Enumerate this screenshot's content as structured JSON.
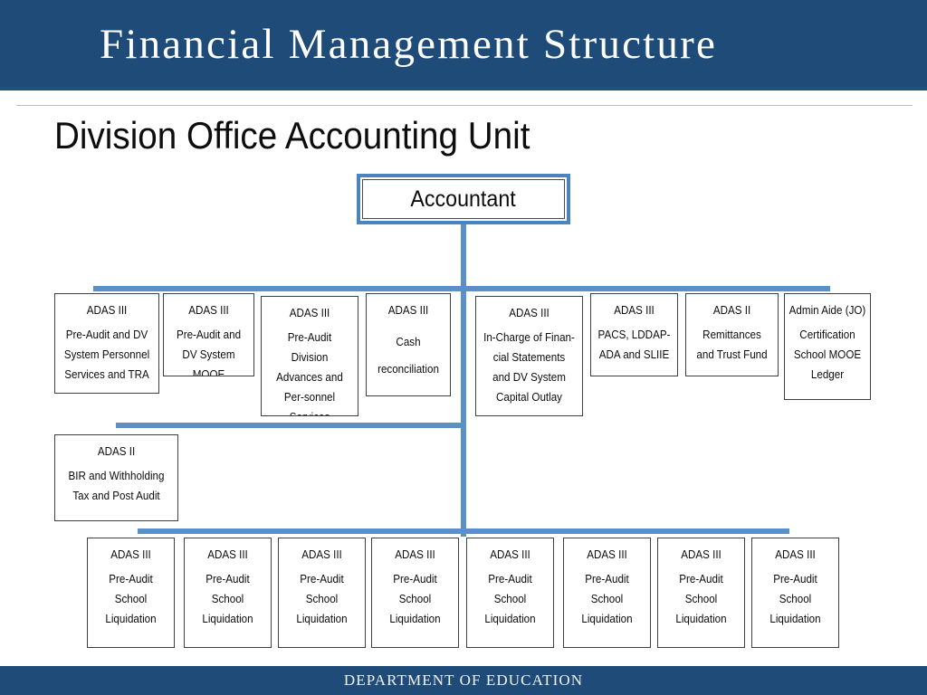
{
  "header": {
    "title": "Financial Management Structure"
  },
  "subtitle": "Division Office Accounting Unit",
  "root": {
    "label": "Accountant"
  },
  "row1": [
    {
      "role": "ADAS III",
      "desc": "Pre-Audit and DV System Personnel Services and TRA"
    },
    {
      "role": "ADAS III",
      "desc": "Pre-Audit and DV System MOOE"
    },
    {
      "role": "ADAS III",
      "desc": "Pre-Audit Division Advances and Per-sonnel Services"
    },
    {
      "role": "ADAS III",
      "desc": "Cash reconciliation"
    },
    {
      "role": "ADAS III",
      "desc": "In-Charge of Finan-cial Statements and DV System Capital Outlay"
    },
    {
      "role": "ADAS III",
      "desc": "PACS, LDDAP-ADA and SLIIE"
    },
    {
      "role": "ADAS II",
      "desc": "Remittances and Trust Fund"
    },
    {
      "role": "Admin Aide (JO)",
      "desc": "Certification School MOOE Ledger"
    }
  ],
  "row2": [
    {
      "role": "ADAS II",
      "desc": "BIR and Withholding Tax and Post Audit"
    }
  ],
  "row3": [
    {
      "role": "ADAS III",
      "desc": "Pre-Audit School Liquidation"
    },
    {
      "role": "ADAS III",
      "desc": "Pre-Audit School Liquidation"
    },
    {
      "role": "ADAS III",
      "desc": "Pre-Audit School Liquidation"
    },
    {
      "role": "ADAS III",
      "desc": "Pre-Audit School Liquidation"
    },
    {
      "role": "ADAS III",
      "desc": "Pre-Audit School Liquidation"
    },
    {
      "role": "ADAS III",
      "desc": "Pre-Audit School Liquidation"
    },
    {
      "role": "ADAS III",
      "desc": "Pre-Audit School Liquidation"
    },
    {
      "role": "ADAS III",
      "desc": "Pre-Audit School Liquidation"
    }
  ],
  "footer": {
    "text": "DEPARTMENT OF EDUCATION"
  },
  "colors": {
    "band": "#1F4B79",
    "connector": "#5B8FC7",
    "root_border": "#4A83BE",
    "box_border": "#3F3F3F",
    "text": "#0D0D0D"
  }
}
